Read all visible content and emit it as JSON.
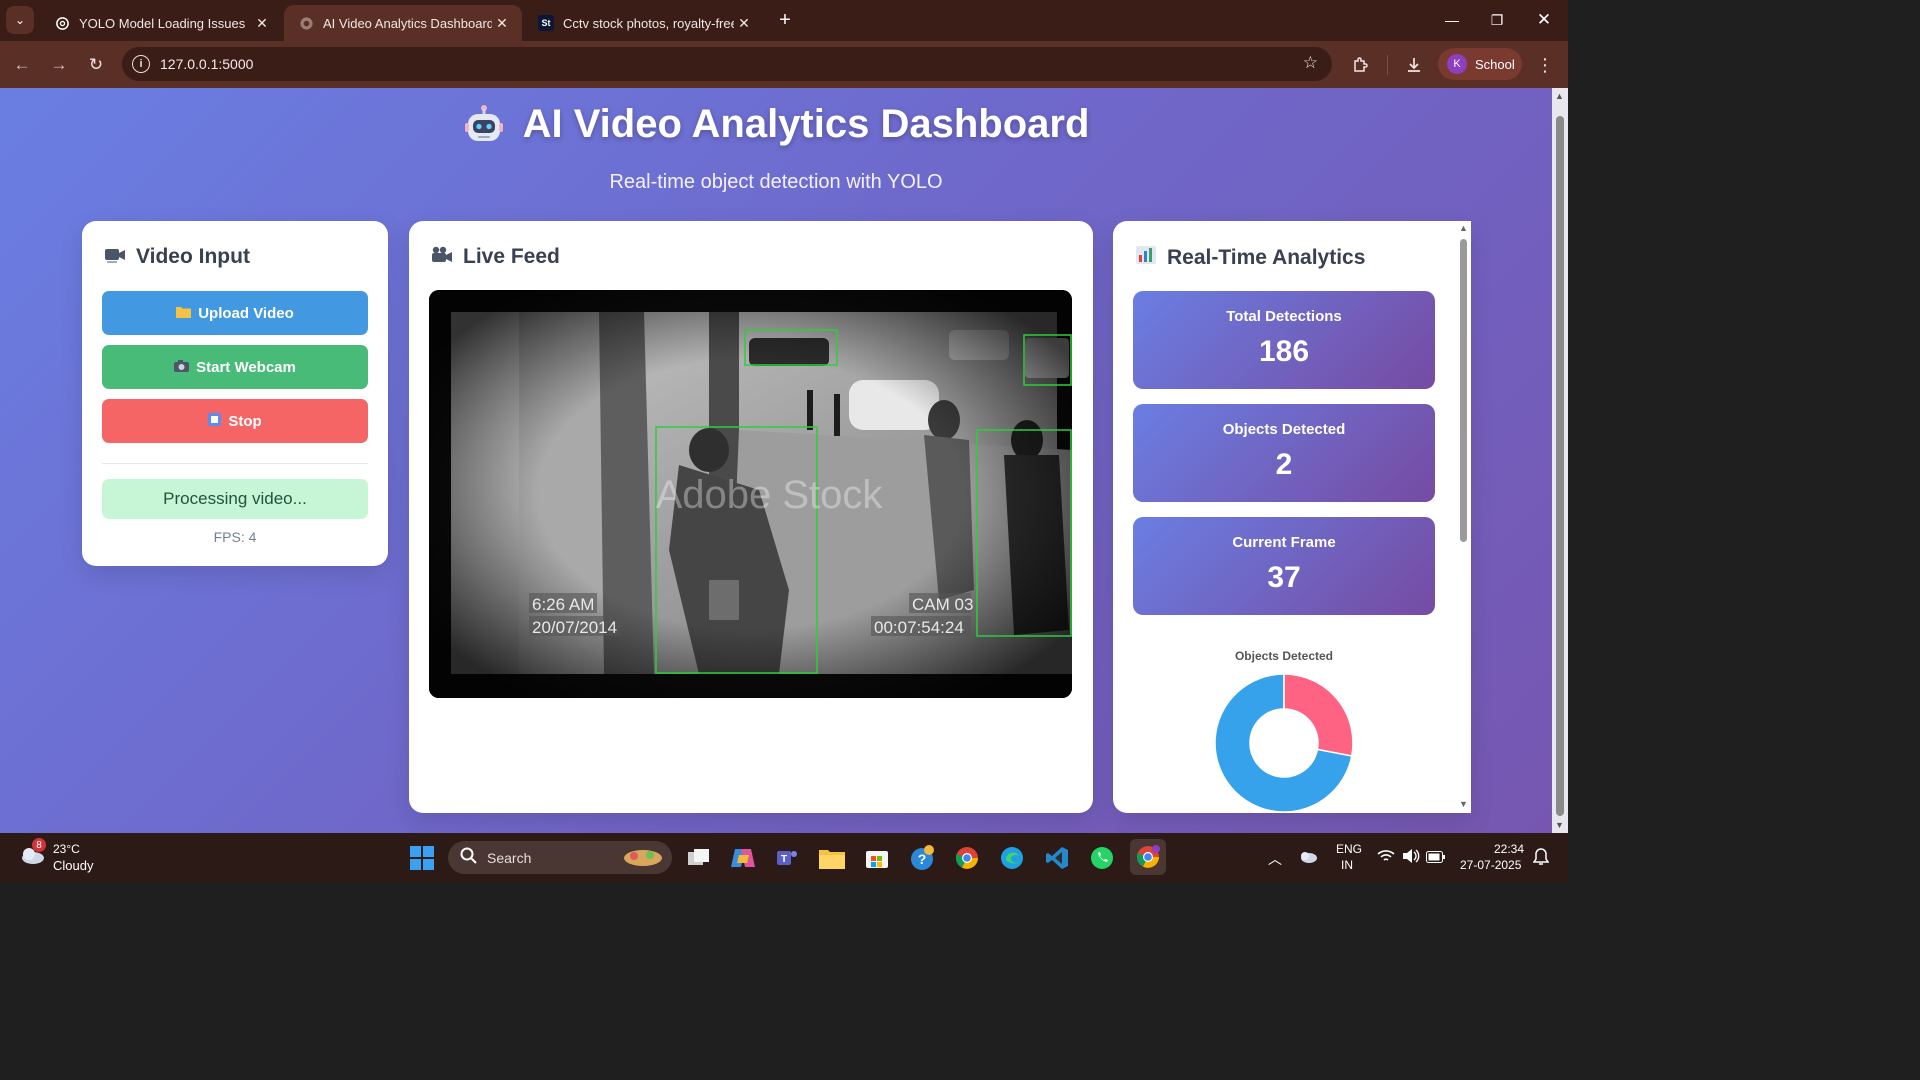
{
  "browser": {
    "tabs": [
      {
        "title": "YOLO Model Loading Issues",
        "favicon": "openai-icon"
      },
      {
        "title": "AI Video Analytics Dashboard",
        "favicon": "globe-icon"
      },
      {
        "title": "Cctv stock photos, royalty-free",
        "favicon": "St"
      }
    ],
    "url": "127.0.0.1:5000",
    "profile": {
      "initial": "K",
      "name": "School"
    }
  },
  "page": {
    "title": "AI Video Analytics Dashboard",
    "subtitle": "Real-time object detection with YOLO"
  },
  "video_input": {
    "heading": "Video Input",
    "upload_label": "Upload Video",
    "webcam_label": "Start Webcam",
    "stop_label": "Stop",
    "status": "Processing video...",
    "fps": "FPS: 4"
  },
  "live_feed": {
    "heading": "Live Feed",
    "overlay_time": "6:26 AM",
    "overlay_date": "20/07/2014",
    "overlay_cam": "CAM 03",
    "overlay_timecode": "00:07:54:24",
    "watermark": "Adobe Stock"
  },
  "analytics": {
    "heading": "Real-Time Analytics",
    "stats": [
      {
        "label": "Total Detections",
        "value": "186"
      },
      {
        "label": "Objects Detected",
        "value": "2"
      },
      {
        "label": "Current Frame",
        "value": "37"
      }
    ],
    "chart_title": "Objects Detected"
  },
  "chart_data": {
    "type": "pie",
    "title": "Objects Detected",
    "slices": [
      {
        "value": 0.72,
        "color": "#36a2eb"
      },
      {
        "value": 0.28,
        "color": "#ff6384"
      }
    ]
  },
  "taskbar": {
    "weather_temp": "23°C",
    "weather_desc": "Cloudy",
    "weather_badge": "8",
    "search_placeholder": "Search",
    "lang_top": "ENG",
    "lang_bottom": "IN",
    "time": "22:34",
    "date": "27-07-2025"
  },
  "colors": {
    "upload": "#4299e1",
    "webcam": "#48bb78",
    "stop": "#f56565",
    "status_bg": "#c6f6d5",
    "detection_box": "#2ecc40"
  }
}
